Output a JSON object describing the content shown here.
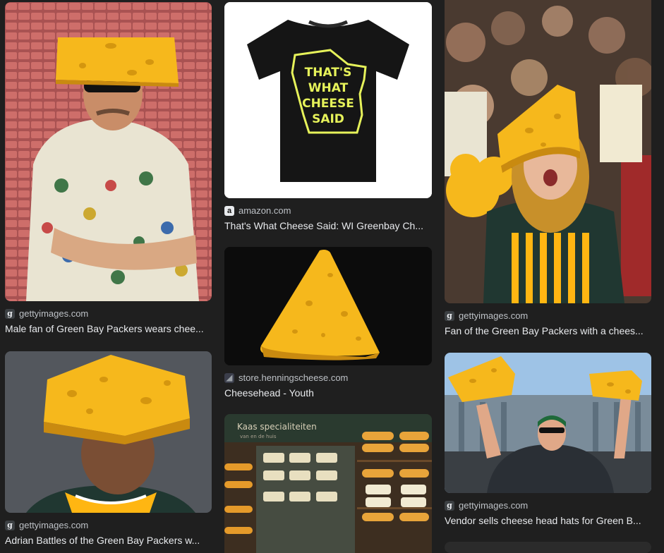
{
  "results": [
    {
      "source": "gettyimages.com",
      "title": "Male fan of Green Bay Packers wears chee...",
      "favicon": "g"
    },
    {
      "source": "amazon.com",
      "title": "That's What Cheese Said: WI Greenbay Ch...",
      "favicon": "a",
      "shirt_text": [
        "THAT'S",
        "WHAT",
        "CHEESE",
        "SAID"
      ]
    },
    {
      "source": "gettyimages.com",
      "title": "Fan of the Green Bay Packers with a chees...",
      "favicon": "g"
    },
    {
      "source": "gettyimages.com",
      "title": "Adrian Battles of the Green Bay Packers w...",
      "favicon": "g"
    },
    {
      "source": "store.henningscheese.com",
      "title": "Cheesehead - Youth",
      "favicon": "h"
    },
    {
      "source": "gettyimages.com",
      "title": "Vendor sells cheese head hats for Green B...",
      "favicon": "g"
    },
    {
      "shop_sign": [
        "Kaas specialiteiten",
        "van en de huis"
      ]
    }
  ],
  "colors": {
    "background": "#1f1f1f",
    "cheese": "#f6b81c",
    "packers_green": "#203731",
    "packers_gold": "#ffb612"
  }
}
